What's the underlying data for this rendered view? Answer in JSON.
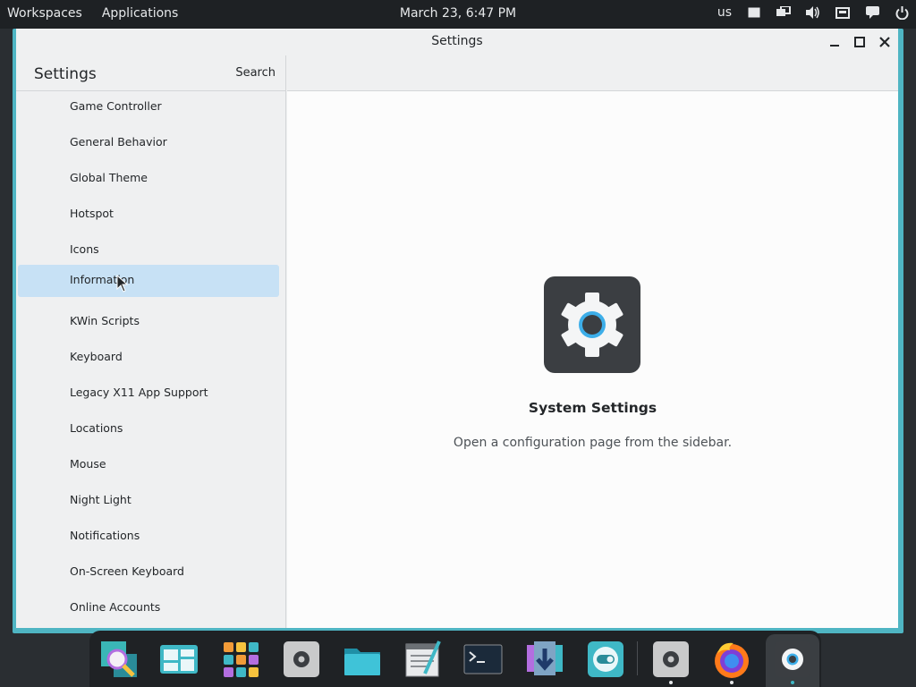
{
  "top_panel": {
    "workspaces": "Workspaces",
    "applications": "Applications",
    "datetime": "March 23, 6:47 PM",
    "keyboard_layout": "us",
    "tray_icons": [
      "clipboard-icon",
      "network-icon",
      "volume-icon",
      "display-icon",
      "notifications-icon",
      "power-icon"
    ]
  },
  "window": {
    "title": "Settings",
    "accent": "#4fb5c3",
    "buttons": [
      "minimize-icon",
      "maximize-icon",
      "close-icon"
    ]
  },
  "sidebar": {
    "title": "Settings",
    "search_label": "Search",
    "items": [
      {
        "label": "Game Controller",
        "selected": false
      },
      {
        "label": "General Behavior",
        "selected": false
      },
      {
        "label": "Global Theme",
        "selected": false
      },
      {
        "label": "Hotspot",
        "selected": false
      },
      {
        "label": "Icons",
        "selected": false
      },
      {
        "label": "Information",
        "selected": true
      },
      {
        "label": "KWin Scripts",
        "selected": false
      },
      {
        "label": "Keyboard",
        "selected": false
      },
      {
        "label": "Legacy X11 App Support",
        "selected": false
      },
      {
        "label": "Locations",
        "selected": false
      },
      {
        "label": "Mouse",
        "selected": false
      },
      {
        "label": "Night Light",
        "selected": false
      },
      {
        "label": "Notifications",
        "selected": false
      },
      {
        "label": "On-Screen Keyboard",
        "selected": false
      },
      {
        "label": "Online Accounts",
        "selected": false
      }
    ]
  },
  "main": {
    "icon": "system-settings-gear-icon",
    "title": "System Settings",
    "subtitle": "Open a configuration page from the sidebar."
  },
  "dock": {
    "items": [
      "search-icon",
      "window-switcher-icon",
      "app-grid-icon",
      "settings-small-icon",
      "files-folder-icon",
      "text-editor-icon",
      "terminal-icon",
      "software-center-icon",
      "toggle-app-icon",
      "settings-running-icon",
      "firefox-icon",
      "system-settings-icon"
    ]
  }
}
